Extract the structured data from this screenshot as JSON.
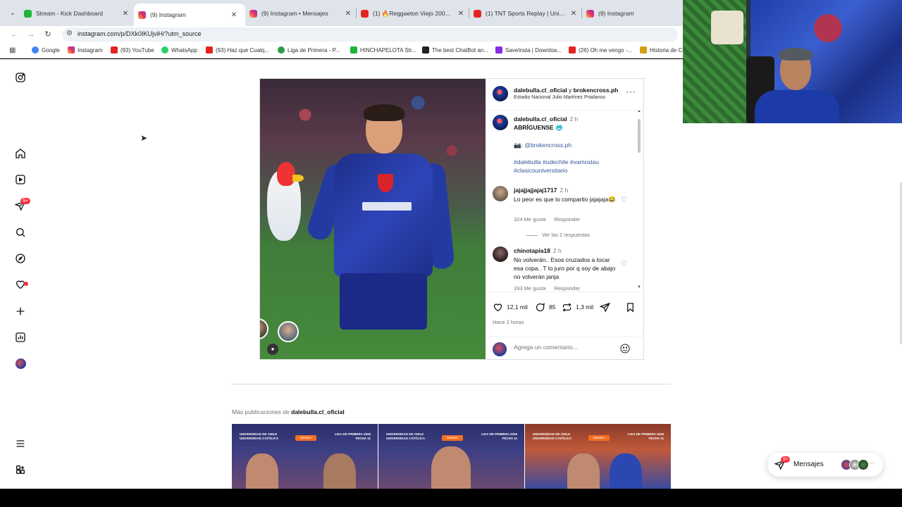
{
  "browser": {
    "tabs": [
      {
        "label": "Stream - Kick Dashboard",
        "icon": "kick",
        "active": false
      },
      {
        "label": "(9) Instagram",
        "icon": "instagram",
        "active": true
      },
      {
        "label": "(9) Instagram • Mensajes",
        "icon": "instagram",
        "active": false
      },
      {
        "label": "(1) 🔥Reggaeton Viejo 2000s - ",
        "icon": "youtube",
        "active": false
      },
      {
        "label": "(1) TNT Sports Replay | Univers",
        "icon": "youtube",
        "active": false
      },
      {
        "label": "(9) Instagram",
        "icon": "instagram",
        "active": false
      }
    ],
    "url": "instagram.com/p/DXk0IKUjviH/?utm_source",
    "bookmarks": [
      {
        "label": "Google",
        "color": "#4285f4"
      },
      {
        "label": "Instagram",
        "color": "#e1306c"
      },
      {
        "label": "(93) YouTube",
        "color": "#e52421"
      },
      {
        "label": "WhatsApp",
        "color": "#25d366"
      },
      {
        "label": "(93) Haz que Cualq...",
        "color": "#e52421"
      },
      {
        "label": "Liga de Primera - P...",
        "color": "#2a9d4a"
      },
      {
        "label": "HINCHAPELOTA Str...",
        "color": "#1eb53a"
      },
      {
        "label": "The best ChatBot an...",
        "color": "#222222"
      },
      {
        "label": "SaveInsta | Downloa...",
        "color": "#8a2be2"
      },
      {
        "label": "(26) Oh me vengo -...",
        "color": "#e52421"
      },
      {
        "label": "Historia de C",
        "color": "#d4a017"
      }
    ]
  },
  "post": {
    "header": {
      "user1": "dalebulla.cl_oficial",
      "joiner": "y",
      "user2": "brokencross.ph",
      "location": "Estadio Nacional Julio Martínez Prádanos"
    },
    "caption": {
      "user": "dalebulla.cl_oficial",
      "time": "2 h",
      "text": "ABRÍGUENSE 🥶",
      "credit_prefix": "📷: ",
      "credit_link": "@brokencross.ph",
      "hashtags": "#dalebulla #udechile #vamoslau #clasicouniversitario"
    },
    "comments": [
      {
        "user": "jajajjajjajaj1717",
        "time": "2 h",
        "text": "Lo peor es que lo compartio jajajaja😂",
        "likes": "324 Me gusta",
        "reply": "Responder",
        "replies_label": "Ver las 2 respuestas"
      },
      {
        "user": "chinotapia18",
        "time": "2 h",
        "text": "No volverán.. Esos cruzados a tocar esa copa.. T lo juro por q soy de abajo no volverán janja",
        "likes": "193 Me gusta",
        "reply": "Responder"
      }
    ],
    "stats": {
      "likes": "12,1 mil",
      "comments": "85",
      "reposts": "1,3 mil"
    },
    "posted_ago": "Hace 2 horas",
    "add_comment_placeholder": "Agrega un comentario..."
  },
  "more": {
    "prefix": "Más publicaciones de",
    "user": "dalebulla.cl_oficial",
    "thumbs": [
      {
        "left_text": "UNIVERSIDAD DE CHILE UNIVERSIDAD CATÓLICA",
        "right_text": "LIGA DE PRIMERA 2026 FECHA 11",
        "sponsor": "betsson"
      },
      {
        "left_text": "UNIVERSIDAD DE CHILE UNIVERSIDAD CATÓLICA",
        "right_text": "LIGA DE PRIMERA 2026 FECHA 11",
        "sponsor": "betsson"
      },
      {
        "left_text": "UNIVERSIDAD DE CHILE UNIVERSIDAD CATÓLICA",
        "right_text": "LIGA DE PRIMERA 2026 FECHA 11",
        "sponsor": "betsson"
      }
    ]
  },
  "sidebar": {
    "notifications_badge": "9+"
  },
  "messages": {
    "label": "Mensajes",
    "badge": "9+"
  },
  "colors": {
    "accent_red": "#ff3040",
    "link_blue": "#385898",
    "muted": "#737373"
  }
}
